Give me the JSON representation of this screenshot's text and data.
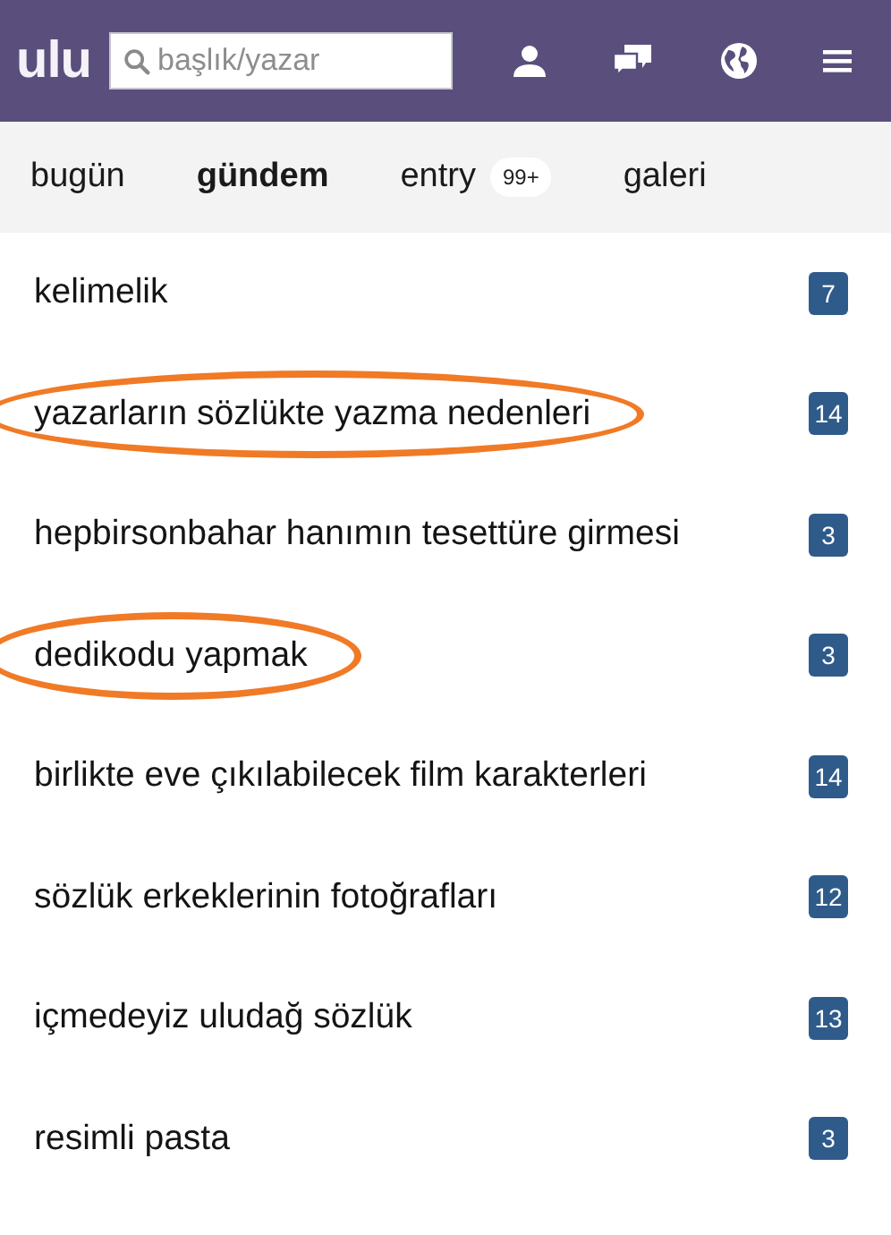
{
  "header": {
    "logo": "ulu",
    "search": {
      "placeholder": "başlık/yazar"
    }
  },
  "tabs": [
    {
      "label": "bugün",
      "selected": false
    },
    {
      "label": "gündem",
      "selected": true
    },
    {
      "label": "entry",
      "selected": false,
      "badge": "99+"
    },
    {
      "label": "galeri",
      "selected": false
    }
  ],
  "topics": [
    {
      "title": "kelimelik",
      "count": "7",
      "circled": false
    },
    {
      "title": "yazarların sözlükte yazma nedenleri",
      "count": "14",
      "circled": true
    },
    {
      "title": "hepbirsonbahar hanımın tesettüre girmesi",
      "count": "3",
      "circled": false
    },
    {
      "title": "dedikodu yapmak",
      "count": "3",
      "circled": true
    },
    {
      "title": "birlikte eve çıkılabilecek film karakterleri",
      "count": "14",
      "circled": false
    },
    {
      "title": "sözlük erkeklerinin fotoğrafları",
      "count": "12",
      "circled": false
    },
    {
      "title": "içmedeyiz uludağ sözlük",
      "count": "13",
      "circled": false
    },
    {
      "title": "resimli pasta",
      "count": "3",
      "circled": false
    }
  ]
}
